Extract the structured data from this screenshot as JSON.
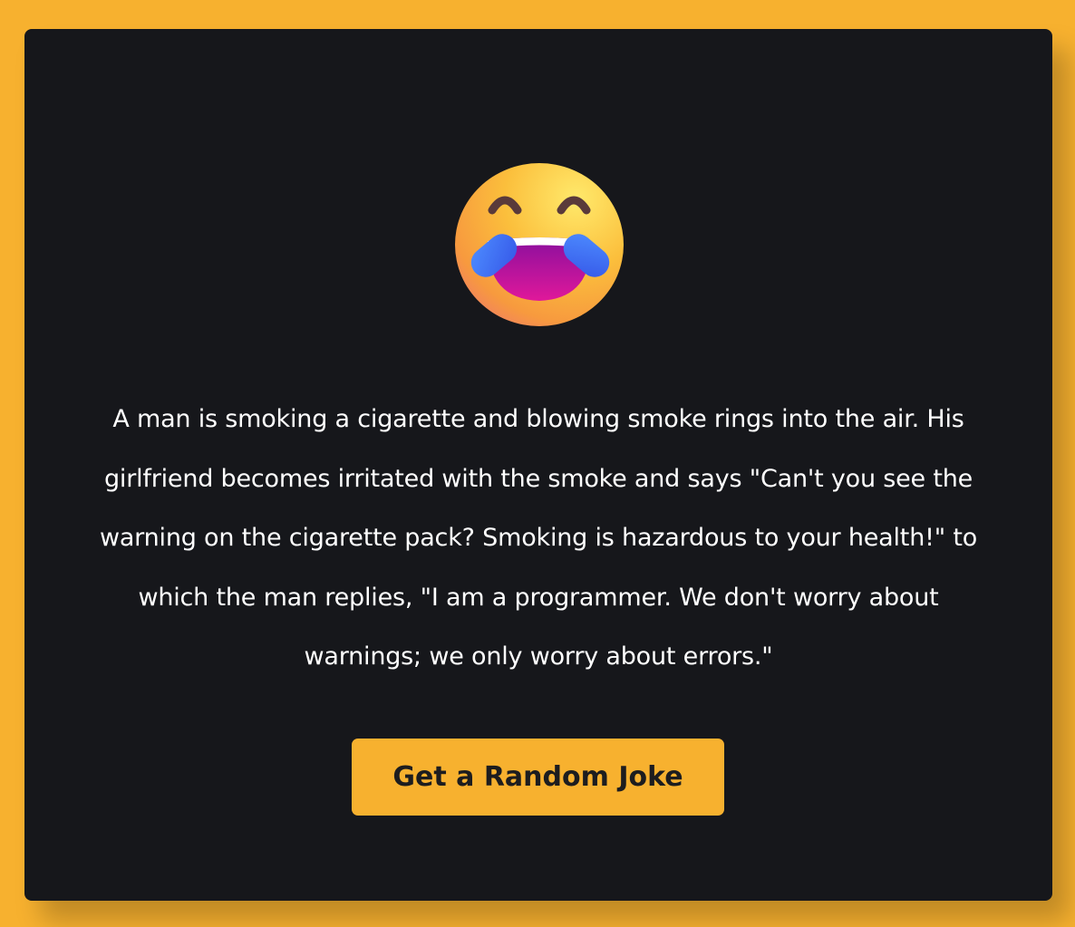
{
  "colors": {
    "page_background": "#f7b12f",
    "card_background": "#16171b",
    "button_background": "#f7b12f",
    "button_text": "#1d1d1f",
    "joke_text": "#ffffff"
  },
  "emoji": {
    "icon": "face-with-tears-of-joy-icon",
    "glyph": "😂"
  },
  "joke": {
    "text": "A man is smoking a cigarette and blowing smoke rings into the air. His girlfriend becomes irritated with the smoke and says \"Can't you see the warning on the cigarette pack? Smoking is hazardous to your health!\" to which the man replies, \"I am a programmer. We don't worry about warnings; we only worry about errors.\""
  },
  "button": {
    "label": "Get a Random Joke"
  }
}
